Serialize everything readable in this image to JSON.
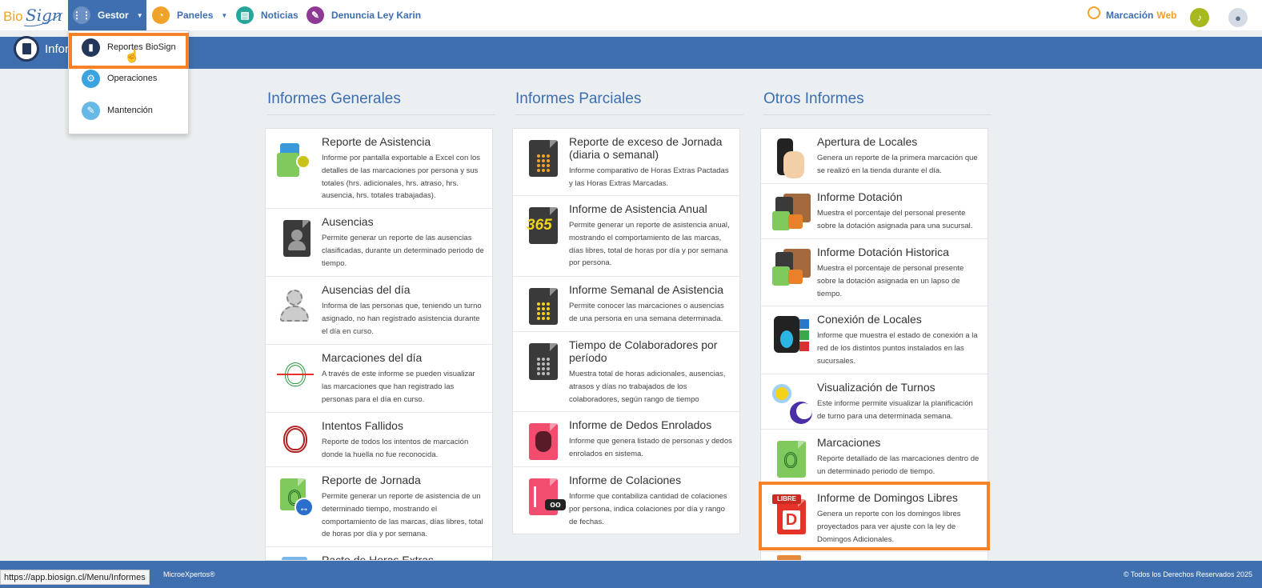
{
  "app": {
    "logo": "BioSign"
  },
  "nav": {
    "gestor": "Gestor",
    "paneles": "Paneles",
    "noticias": "Noticias",
    "denuncia": "Denuncia Ley Karin",
    "marcacion": "Marcación",
    "marcacion_web": "Web"
  },
  "header": {
    "title": "Infor"
  },
  "dropdown": {
    "items": [
      {
        "label": "Reportes BioSign"
      },
      {
        "label": "Operaciones"
      },
      {
        "label": "Mantención"
      }
    ]
  },
  "columns": [
    {
      "title": "Informes Generales",
      "items": [
        {
          "title": "Reporte de Asistencia",
          "desc": "Informe por pantalla exportable a Excel con los detalles de las marcaciones por persona y sus totales (hrs. adicionales, hrs. atraso, hrs. ausencia, hrs. totales trabajadas).",
          "icon": "asistencia-icon"
        },
        {
          "title": "Ausencias",
          "desc": "Permite generar un reporte de las ausencias clasificadas, durante un determinado periodo de tiempo.",
          "icon": "ausencias-icon"
        },
        {
          "title": "Ausencias del día",
          "desc": "Informa de las personas que, teniendo un turno asignado, no han registrado asistencia durante el día en curso.",
          "icon": "ausencias-dia-icon"
        },
        {
          "title": "Marcaciones del día",
          "desc": "A través de este informe se pueden visualizar las marcaciones que han registrado las personas para el día en curso.",
          "icon": "marcaciones-dia-icon"
        },
        {
          "title": "Intentos Fallidos",
          "desc": "Reporte de todos los intentos de marcación donde la huella no fue reconocida.",
          "icon": "intentos-fallidos-icon"
        },
        {
          "title": "Reporte de Jornada",
          "desc": "Permite generar un reporte de asistencia de un determinado tiempo, mostrando el comportamiento de las marcas, días libres, total de horas por día y por semana.",
          "icon": "jornada-icon"
        },
        {
          "title": "Pacto de Horas Extras",
          "desc": "",
          "icon": "pacto-icon"
        }
      ]
    },
    {
      "title": "Informes Parciales",
      "items": [
        {
          "title": "Reporte de exceso de Jornada (diaria o semanal)",
          "desc": "Informe comparativo de Horas Extras Pactadas y las Horas Extras Marcadas.",
          "icon": "calculator-icon"
        },
        {
          "title": "Informe de Asistencia Anual",
          "desc": "Permite generar un reporte de asistencia anual, mostrando el comportamiento de las marcas, días libres, total de horas por día y por semana por persona.",
          "icon": "365-icon",
          "badge": "365"
        },
        {
          "title": "Informe Semanal de Asistencia",
          "desc": "Permite conocer las marcaciones o ausencias de una persona en una semana determinada.",
          "icon": "calculator-yellow-icon"
        },
        {
          "title": "Tiempo de Colaboradores por período",
          "desc": "Muestra total de horas adicionales, ausencias, atrasos y días no trabajados de los colaboradores, según rango de tiempo",
          "icon": "calculator-gray-icon"
        },
        {
          "title": "Informe de Dedos Enrolados",
          "desc": "Informe que genera listado de personas y dedos enrolados en sistema.",
          "icon": "hand-icon"
        },
        {
          "title": "Informe de Colaciones",
          "desc": "Informe que contabiliza cantidad de colaciones por persona, indica colaciones por día y rango de fechas.",
          "icon": "colaciones-icon"
        }
      ]
    },
    {
      "title": "Otros Informes",
      "items": [
        {
          "title": "Apertura de Locales",
          "desc": "Genera un reporte de la primera marcación que se realizó en la tienda durante el día.",
          "icon": "apertura-icon"
        },
        {
          "title": "Informe Dotación",
          "desc": "Muestra el porcentaje del personal presente sobre la dotación asignada para una sucursal.",
          "icon": "dotacion-icon"
        },
        {
          "title": "Informe Dotación Historica",
          "desc": "Muestra el porcentaje de personal presente sobre la dotación asignada en un lapso de tiempo.",
          "icon": "dotacion-historica-icon"
        },
        {
          "title": "Conexión de Locales",
          "desc": "Informe que muestra el estado de conexión a la red de los distintos puntos instalados en las sucursales.",
          "icon": "conexion-icon"
        },
        {
          "title": "Visualización de Turnos",
          "desc": "Este informe permite visualizar la planificación de turno para una determinada semana.",
          "icon": "turnos-icon"
        },
        {
          "title": "Marcaciones",
          "desc": "Reporte detallado de las marcaciones dentro de un determinado periodo de tiempo.",
          "icon": "marcaciones-icon"
        },
        {
          "title": "Informe de Domingos Libres",
          "desc": "Genera un reporte con los domingos libres proyectados para ver ajuste con la ley de Domingos Adicionales.",
          "icon": "domingos-libres-icon",
          "badge": "LIBRE",
          "letter": "D"
        }
      ]
    }
  ],
  "footer": {
    "left": "MicroeXpertos®",
    "right": "© Todos los Derechos Reservados 2025"
  },
  "status_url": "https://app.biosign.cl/Menu/Informes",
  "colors": {
    "primary": "#3f6fae",
    "accent": "#f58228",
    "text_link": "#3d6eb0"
  }
}
